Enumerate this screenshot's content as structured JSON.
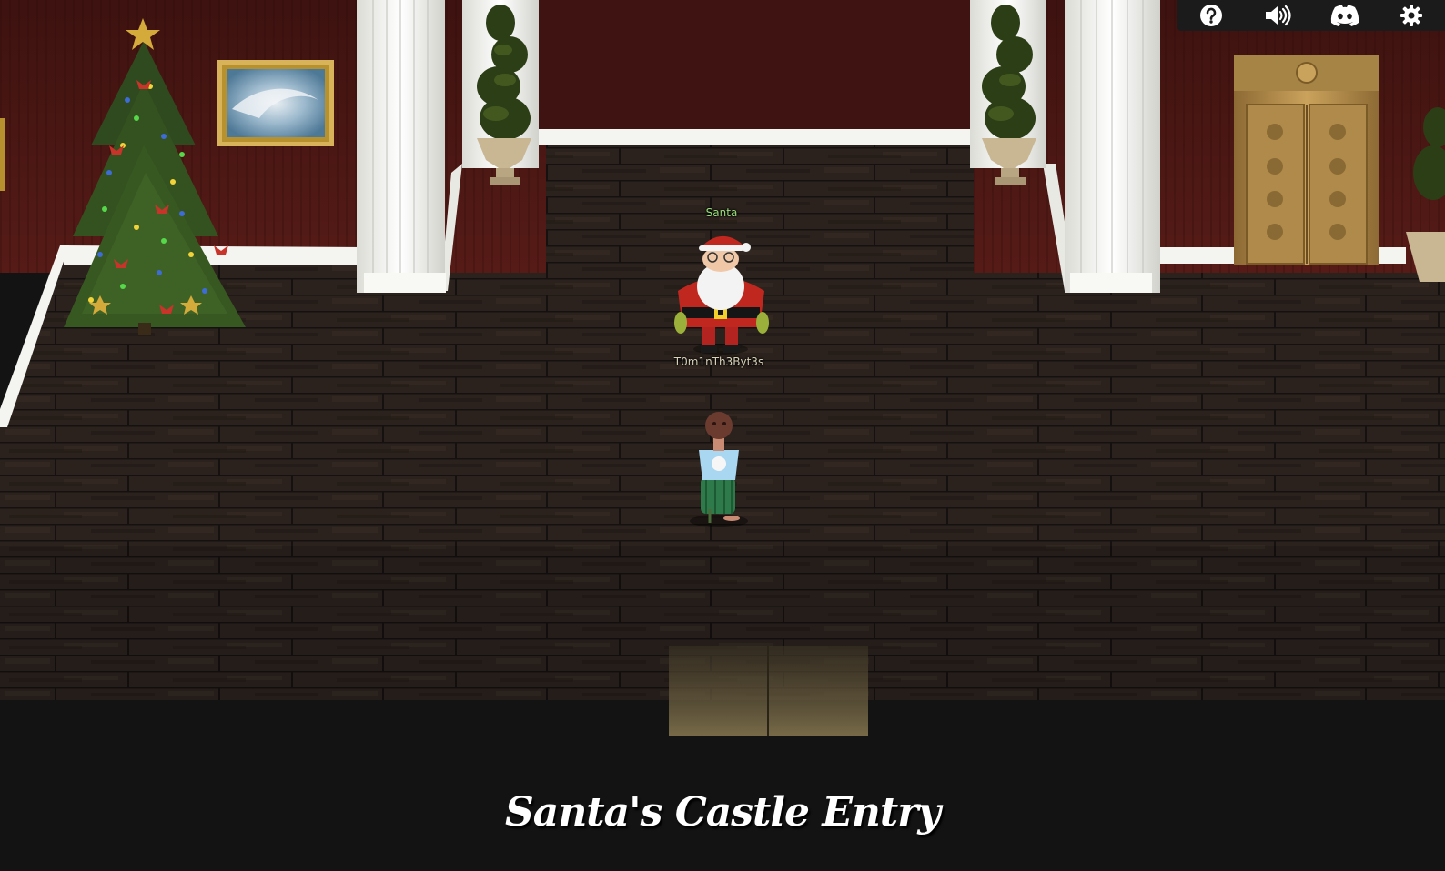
{
  "room": {
    "title": "Santa's Castle Entry"
  },
  "characters": {
    "npc": {
      "name": "Santa"
    },
    "player": {
      "name": "T0m1nTh3Byt3s"
    }
  },
  "toolbar": {
    "buttons": [
      {
        "icon": "help-icon"
      },
      {
        "icon": "sound-icon"
      },
      {
        "icon": "discord-icon"
      },
      {
        "icon": "settings-icon"
      }
    ]
  },
  "colors": {
    "wall": "#4a1714",
    "floor": "#2b221d",
    "pillar": "#f2f2ee",
    "door": "#b8904a",
    "npc_name": "#9be07a",
    "player_name": "#d8d2b8",
    "toolbar_bg": "#1b1b1b"
  }
}
